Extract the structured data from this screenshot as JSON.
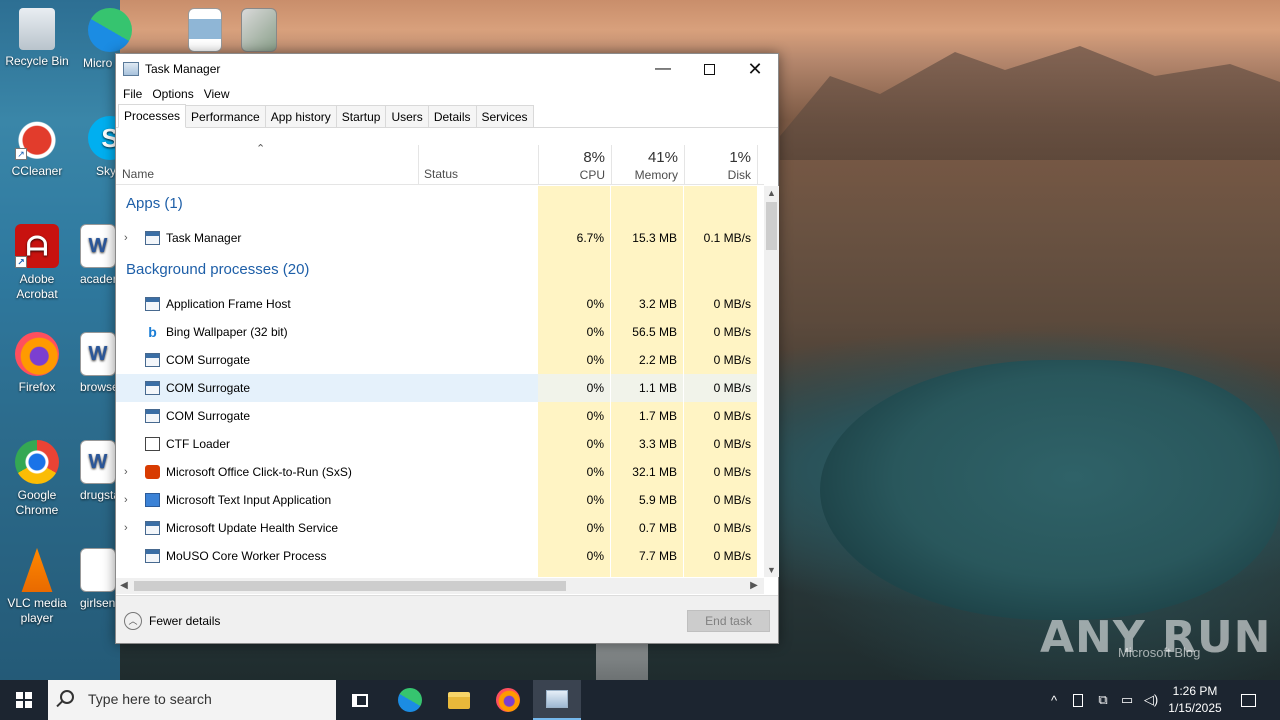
{
  "desktop": {
    "icons": [
      {
        "label": "Recycle Bin"
      },
      {
        "label": "Micro Edg"
      },
      {
        "label": "CCleaner"
      },
      {
        "label": "Sky"
      },
      {
        "label": "Adobe Acrobat"
      },
      {
        "label": "acader"
      },
      {
        "label": "Firefox"
      },
      {
        "label": "browse"
      },
      {
        "label": "Google Chrome"
      },
      {
        "label": "drugsta"
      },
      {
        "label": "VLC media player"
      },
      {
        "label": "girlsen"
      }
    ]
  },
  "window": {
    "title": "Task Manager",
    "menu": [
      "File",
      "Options",
      "View"
    ],
    "tabs": [
      "Processes",
      "Performance",
      "App history",
      "Startup",
      "Users",
      "Details",
      "Services"
    ],
    "active_tab": "Processes",
    "columns": {
      "name": "Name",
      "status": "Status",
      "cpu": {
        "pct": "8%",
        "label": "CPU"
      },
      "memory": {
        "pct": "41%",
        "label": "Memory"
      },
      "disk": {
        "pct": "1%",
        "label": "Disk"
      }
    },
    "groups": {
      "apps": "Apps (1)",
      "background": "Background processes (20)"
    },
    "apps": [
      {
        "name": "Task Manager",
        "cpu": "6.7%",
        "memory": "15.3 MB",
        "disk": "0.1 MB/s",
        "expandable": true,
        "icon": "task-manager-icon"
      }
    ],
    "background": [
      {
        "name": "Application Frame Host",
        "cpu": "0%",
        "memory": "3.2 MB",
        "disk": "0 MB/s",
        "expandable": false,
        "icon": "window-icon"
      },
      {
        "name": "Bing Wallpaper (32 bit)",
        "cpu": "0%",
        "memory": "56.5 MB",
        "disk": "0 MB/s",
        "expandable": false,
        "icon": "bing-icon"
      },
      {
        "name": "COM Surrogate",
        "cpu": "0%",
        "memory": "2.2 MB",
        "disk": "0 MB/s",
        "expandable": false,
        "icon": "window-icon"
      },
      {
        "name": "COM Surrogate",
        "cpu": "0%",
        "memory": "1.1 MB",
        "disk": "0 MB/s",
        "expandable": false,
        "icon": "window-icon",
        "selected": true
      },
      {
        "name": "COM Surrogate",
        "cpu": "0%",
        "memory": "1.7 MB",
        "disk": "0 MB/s",
        "expandable": false,
        "icon": "window-icon"
      },
      {
        "name": "CTF Loader",
        "cpu": "0%",
        "memory": "3.3 MB",
        "disk": "0 MB/s",
        "expandable": false,
        "icon": "edit-icon"
      },
      {
        "name": "Microsoft Office Click-to-Run (SxS)",
        "cpu": "0%",
        "memory": "32.1 MB",
        "disk": "0 MB/s",
        "expandable": true,
        "icon": "office-icon"
      },
      {
        "name": "Microsoft Text Input Application",
        "cpu": "0%",
        "memory": "5.9 MB",
        "disk": "0 MB/s",
        "expandable": true,
        "icon": "keyboard-icon"
      },
      {
        "name": "Microsoft Update Health Service",
        "cpu": "0%",
        "memory": "0.7 MB",
        "disk": "0 MB/s",
        "expandable": true,
        "icon": "window-icon"
      },
      {
        "name": "MoUSO Core Worker Process",
        "cpu": "0%",
        "memory": "7.7 MB",
        "disk": "0 MB/s",
        "expandable": false,
        "icon": "window-icon"
      }
    ],
    "footer": {
      "fewer_details": "Fewer details",
      "end_task": "End task"
    }
  },
  "watermark": {
    "text": "ANY RUN",
    "sub": "Microsoft Blog"
  },
  "taskbar": {
    "search_placeholder": "Type here to search",
    "clock_time": "1:26 PM",
    "clock_date": "1/15/2025"
  }
}
